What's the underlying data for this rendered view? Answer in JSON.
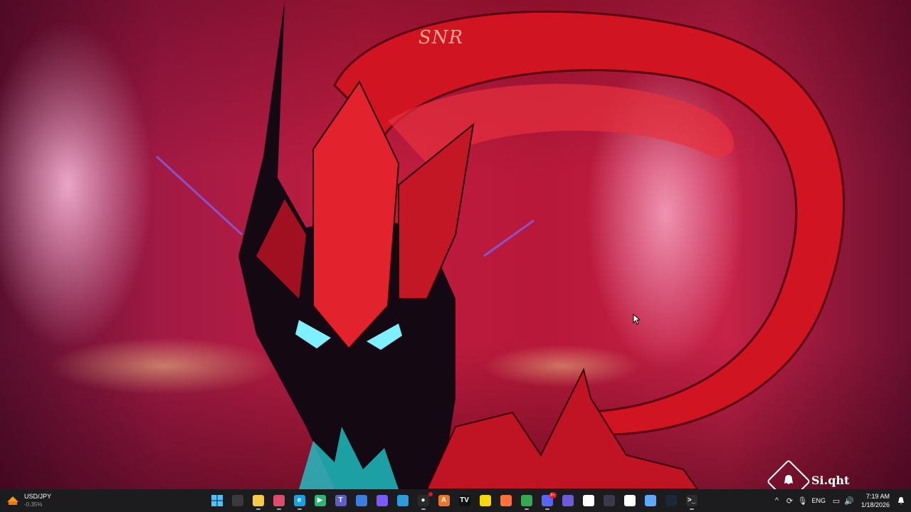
{
  "wallpaper": {
    "watermark": "SNR",
    "brand_text": "Si.qht"
  },
  "taskbar": {
    "widget": {
      "pair": "USD/JPY",
      "change": "-0.35%",
      "icon": "currency-exchange-icon"
    },
    "apps": [
      {
        "name": "start-button",
        "glyph": "",
        "color": "#4cc2ff",
        "running": false
      },
      {
        "name": "task-view-button",
        "glyph": "",
        "color": "#3a3a3a",
        "running": false
      },
      {
        "name": "file-explorer-app",
        "glyph": "",
        "color": "#f7c948",
        "running": true
      },
      {
        "name": "snipping-app",
        "glyph": "",
        "color": "#e04b6b",
        "running": true
      },
      {
        "name": "edge-app",
        "glyph": "e",
        "color": "#1aa0e0",
        "running": true
      },
      {
        "name": "play-store-app",
        "glyph": "▶",
        "color": "#2bb673",
        "running": false
      },
      {
        "name": "teams-app",
        "glyph": "T",
        "color": "#5b5fc7",
        "running": false
      },
      {
        "name": "microsoft-store-app",
        "glyph": "",
        "color": "#3c7de0",
        "running": false
      },
      {
        "name": "copilot-app",
        "glyph": "",
        "color": "#7a5af8",
        "running": false
      },
      {
        "name": "whiteboard-app",
        "glyph": "",
        "color": "#2d9cdb",
        "running": false
      },
      {
        "name": "obs-app",
        "glyph": "●",
        "color": "#2a2a2a",
        "running": true,
        "badge": ""
      },
      {
        "name": "affinity-app",
        "glyph": "A",
        "color": "#e8762c",
        "running": false
      },
      {
        "name": "tradingview-app",
        "glyph": "TV",
        "color": "#111111",
        "running": false
      },
      {
        "name": "sticky-notes-app",
        "glyph": "",
        "color": "#f5d90a",
        "running": false
      },
      {
        "name": "firefox-app",
        "glyph": "",
        "color": "#ff7139",
        "running": false
      },
      {
        "name": "chrome-app",
        "glyph": "",
        "color": "#34a853",
        "running": true
      },
      {
        "name": "discord-app",
        "glyph": "",
        "color": "#5865f2",
        "running": true,
        "badge": "9+"
      },
      {
        "name": "gamepad-app",
        "glyph": "",
        "color": "#6e5bd9",
        "running": false
      },
      {
        "name": "mail-app",
        "glyph": "",
        "color": "#ffffff",
        "running": false
      },
      {
        "name": "calculator-app",
        "glyph": "",
        "color": "#3a3a48",
        "running": false
      },
      {
        "name": "media-app",
        "glyph": "",
        "color": "#ffffff",
        "running": false
      },
      {
        "name": "vpn-app",
        "glyph": "",
        "color": "#5fa8ff",
        "running": false
      },
      {
        "name": "steam-app",
        "glyph": "",
        "color": "#1b2838",
        "running": false
      },
      {
        "name": "terminal-app",
        "glyph": ">_",
        "color": "#2b2b2b",
        "running": true
      }
    ],
    "tray": {
      "language": "ENG",
      "time": "7:19 AM",
      "date": "1/18/2026"
    }
  }
}
